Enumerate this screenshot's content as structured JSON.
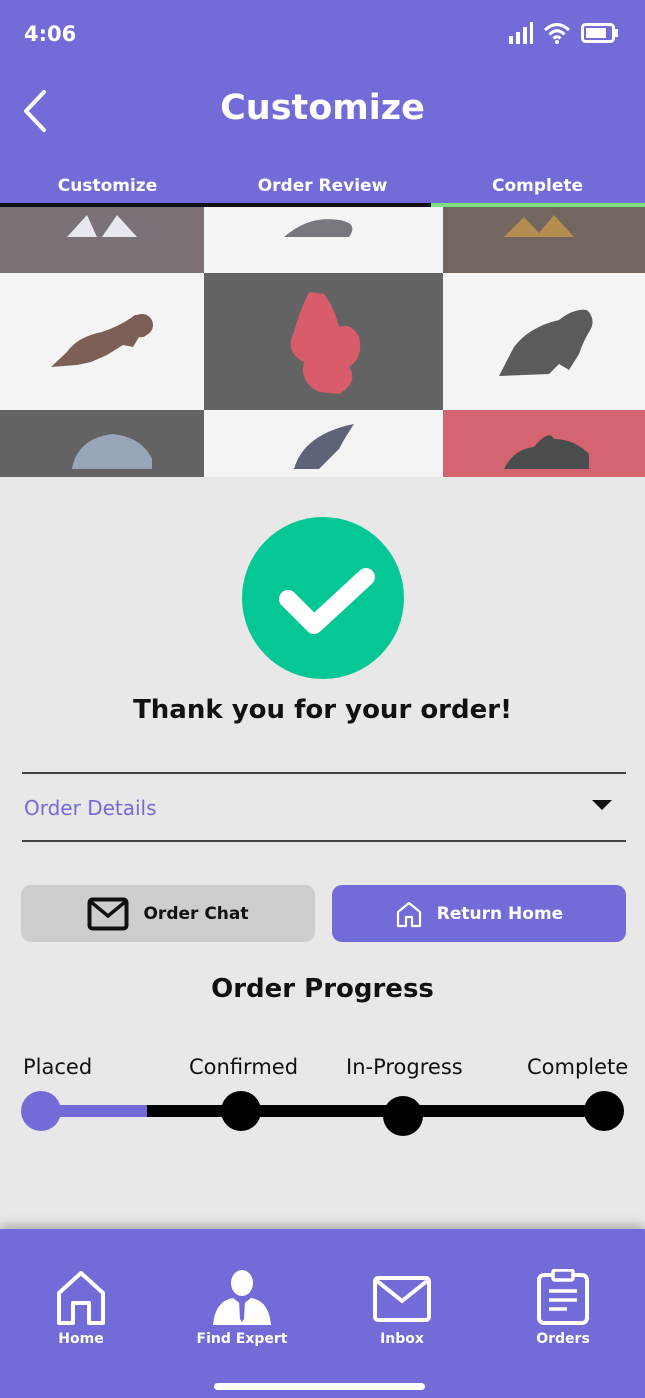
{
  "status_bar": {
    "time": "4:06"
  },
  "header": {
    "title": "Customize"
  },
  "tabs": [
    {
      "label": "Customize",
      "active": false
    },
    {
      "label": "Order Review",
      "active": false
    },
    {
      "label": "Complete",
      "active": true
    }
  ],
  "gallery": [
    {
      "bg": "#7b7179",
      "fg": "#e8e6ee",
      "icon": "figure-icon"
    },
    {
      "bg": "#f4f4f4",
      "fg": "#77777d",
      "icon": "animal-icon"
    },
    {
      "bg": "#73665f",
      "fg": "#b58d50",
      "icon": "animal-icon"
    },
    {
      "bg": "#f4f4f4",
      "fg": "#7c6055",
      "icon": "ram-icon"
    },
    {
      "bg": "#636363",
      "fg": "#d85c6a",
      "icon": "dragon-icon"
    },
    {
      "bg": "#f4f4f4",
      "fg": "#5c5a5c",
      "icon": "bear-icon"
    },
    {
      "bg": "#636363",
      "fg": "#97a7b9",
      "icon": "rhino-icon"
    },
    {
      "bg": "#f4f4f4",
      "fg": "#5f6377",
      "icon": "wing-icon"
    },
    {
      "bg": "#d4646f",
      "fg": "#4a4c4e",
      "icon": "bull-icon"
    }
  ],
  "confirmation": {
    "message": "Thank you for your order!"
  },
  "order_details": {
    "label": "Order Details"
  },
  "actions": {
    "chat_label": "Order Chat",
    "home_label": "Return Home"
  },
  "progress": {
    "title": "Order Progress",
    "stages": [
      "Placed",
      "Confirmed",
      "In-Progress",
      "Complete"
    ],
    "fill_fraction": 0.19
  },
  "bottom_nav": [
    {
      "label": "Home",
      "icon": "home-icon"
    },
    {
      "label": "Find Expert",
      "icon": "expert-icon"
    },
    {
      "label": "Inbox",
      "icon": "mail-icon"
    },
    {
      "label": "Orders",
      "icon": "clipboard-icon"
    }
  ],
  "colors": {
    "primary": "#736bd7",
    "success": "#04c795",
    "tab_indicator": "#7ee07e",
    "background": "#e8e8e8"
  }
}
